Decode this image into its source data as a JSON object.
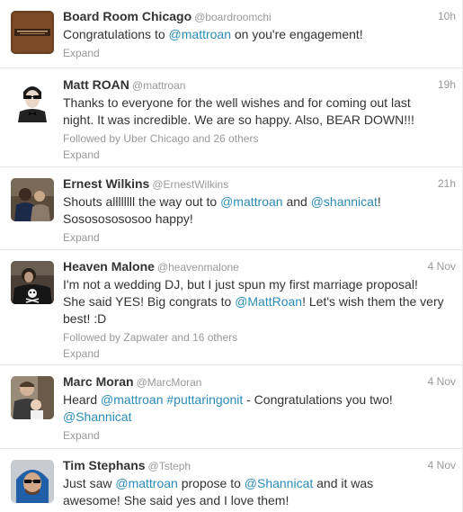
{
  "tweets": [
    {
      "name": "Board Room Chicago",
      "handle": "@boardroomchi",
      "time": "10h",
      "avatar_icon": "boardroom-logo-avatar",
      "lines": [
        [
          {
            "t": "Congratulations to "
          },
          {
            "t": "@mattroan",
            "link": true
          },
          {
            "t": " on you're engagement!"
          }
        ]
      ],
      "followed": "",
      "expand": "Expand"
    },
    {
      "name": "Matt ROAN",
      "handle": "@mattroan",
      "time": "19h",
      "avatar_icon": "man-sunglasses-bowtie-avatar",
      "lines": [
        [
          {
            "t": "Thanks to everyone for the well wishes and for coming out last"
          }
        ],
        [
          {
            "t": "night. It was incredible. We are so happy. Also, BEAR DOWN!!!"
          }
        ]
      ],
      "followed": "Followed by Uber Chicago and 26 others",
      "expand": "Expand"
    },
    {
      "name": "Ernest Wilkins",
      "handle": "@ErnestWilkins",
      "time": "21h",
      "avatar_icon": "two-people-photo-avatar",
      "lines": [
        [
          {
            "t": "Shouts allllllll the way out to "
          },
          {
            "t": "@mattroan",
            "link": true
          },
          {
            "t": " and "
          },
          {
            "t": "@shannicat",
            "link": true
          },
          {
            "t": "!"
          }
        ],
        [
          {
            "t": "Sosososososoo happy!"
          }
        ]
      ],
      "followed": "",
      "expand": "Expand"
    },
    {
      "name": "Heaven Malone",
      "handle": "@heavenmalone",
      "time": "4 Nov",
      "avatar_icon": "skull-shirt-avatar",
      "lines": [
        [
          {
            "t": "I'm not a wedding DJ, but I just spun my first marriage proposal!"
          }
        ],
        [
          {
            "t": "She said YES! Big congrats to "
          },
          {
            "t": "@MattRoan",
            "link": true
          },
          {
            "t": "! Let's wish them the very"
          }
        ],
        [
          {
            "t": "best! :D"
          }
        ]
      ],
      "followed": "Followed by Zapwater and 16 others",
      "expand": "Expand"
    },
    {
      "name": "Marc Moran",
      "handle": "@MarcMoran",
      "time": "4 Nov",
      "avatar_icon": "man-with-baby-avatar",
      "lines": [
        [
          {
            "t": "Heard "
          },
          {
            "t": "@mattroan",
            "link": true
          },
          {
            "t": " "
          },
          {
            "t": "#puttaringonit",
            "link": true
          },
          {
            "t": " - Congratulations you two!"
          }
        ],
        [
          {
            "t": "@Shannicat",
            "link": true
          }
        ]
      ],
      "followed": "",
      "expand": "Expand"
    },
    {
      "name": "Tim Stephans",
      "handle": "@Tsteph",
      "time": "4 Nov",
      "avatar_icon": "man-blue-hood-sunglasses-avatar",
      "lines": [
        [
          {
            "t": "Just saw "
          },
          {
            "t": "@mattroan",
            "link": true
          },
          {
            "t": " propose to "
          },
          {
            "t": "@Shannicat",
            "link": true
          },
          {
            "t": " and it was"
          }
        ],
        [
          {
            "t": "awesome! She said yes and I love them!"
          }
        ]
      ],
      "followed": "",
      "expand": ""
    }
  ]
}
